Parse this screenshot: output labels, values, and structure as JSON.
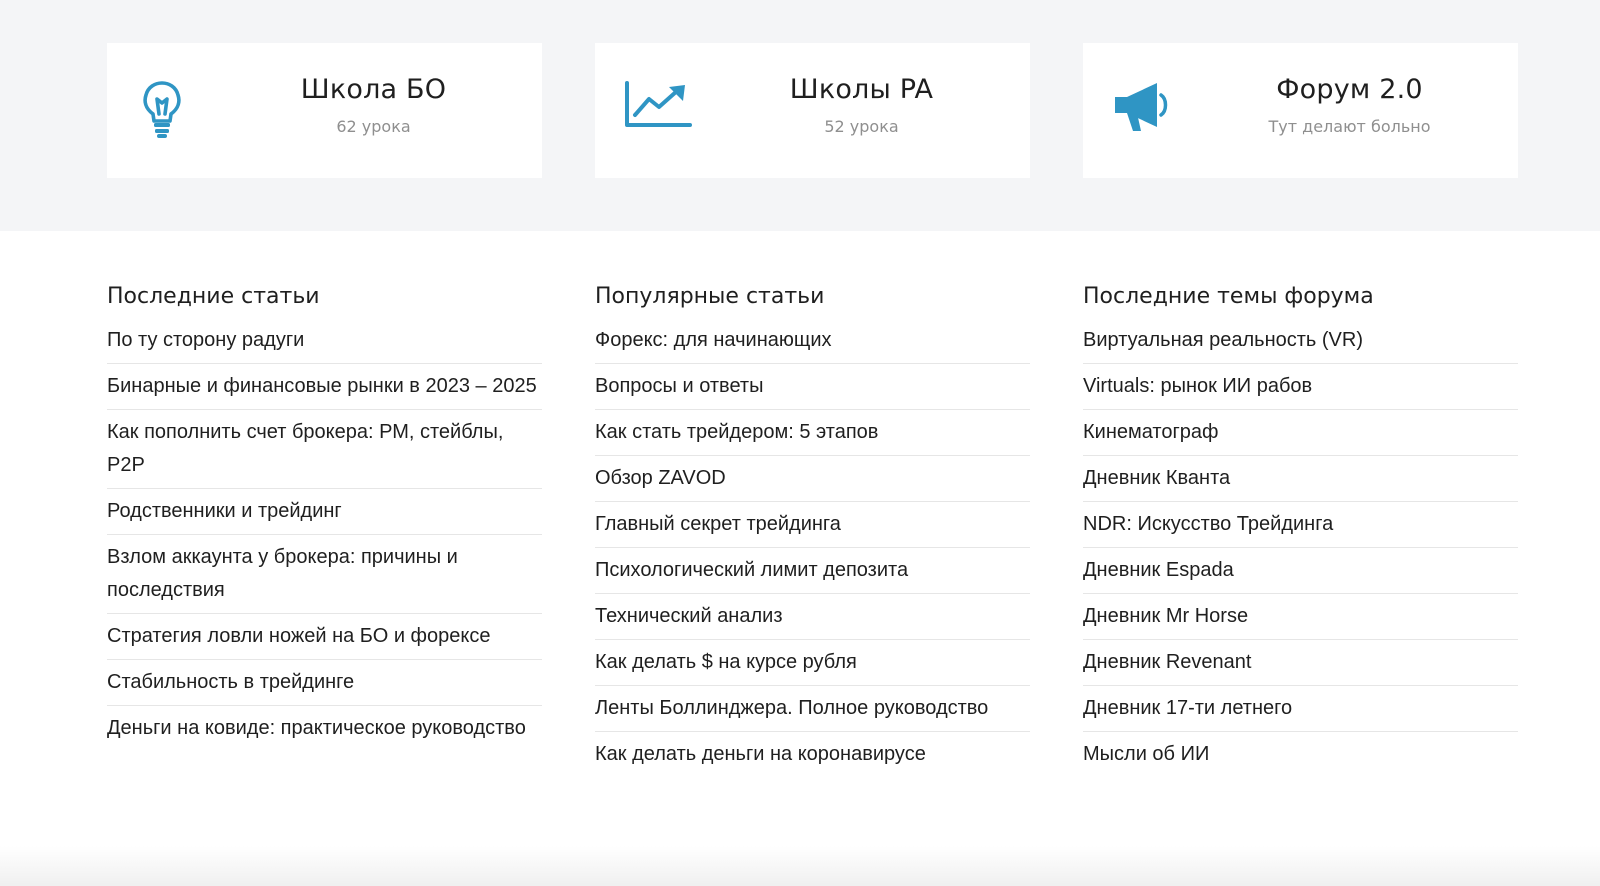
{
  "cards": [
    {
      "title": "Школа БО",
      "subtitle": "62 урока",
      "icon": "lightbulb-icon"
    },
    {
      "title": "Школы PA",
      "subtitle": "52 урока",
      "icon": "chart-growth-icon"
    },
    {
      "title": "Форум 2.0",
      "subtitle": "Тут делают больно",
      "icon": "megaphone-icon"
    }
  ],
  "accent_color": "#2f95c4",
  "columns": {
    "latest": {
      "title": "Последние статьи",
      "items": [
        "По ту сторону радуги",
        "Бинарные и финансовые рынки в 2023 – 2025",
        "Как пополнить счет брокера: РМ, стейблы, P2P",
        "Родственники и трейдинг",
        "Взлом аккаунта у брокера: причины и последствия",
        "Стратегия ловли ножей на БО и форексе",
        "Стабильность в трейдинге",
        "Деньги на ковиде: практическое руководство"
      ]
    },
    "popular": {
      "title": "Популярные статьи",
      "items": [
        "Форекс: для начинающих",
        "Вопросы и ответы",
        "Как стать трейдером: 5 этапов",
        "Обзор ZAVOD",
        "Главный секрет трейдинга",
        "Психологический лимит депозита",
        "Технический анализ",
        "Как делать $ на курсе рубля",
        "Ленты Боллинджера. Полное руководство",
        "Как делать деньги на коронавирусе"
      ]
    },
    "forum": {
      "title": "Последние темы форума",
      "items": [
        "Виртуальная реальность (VR)",
        "Virtuals: рынок ИИ рабов",
        "Кинематограф",
        "Дневник Кванта",
        "NDR: Искусство Трейдинга",
        "Дневник Espada",
        "Дневник Mr Horse",
        "Дневник Revenant",
        "Дневник 17-ти летнего",
        "Мысли об ИИ"
      ]
    }
  }
}
